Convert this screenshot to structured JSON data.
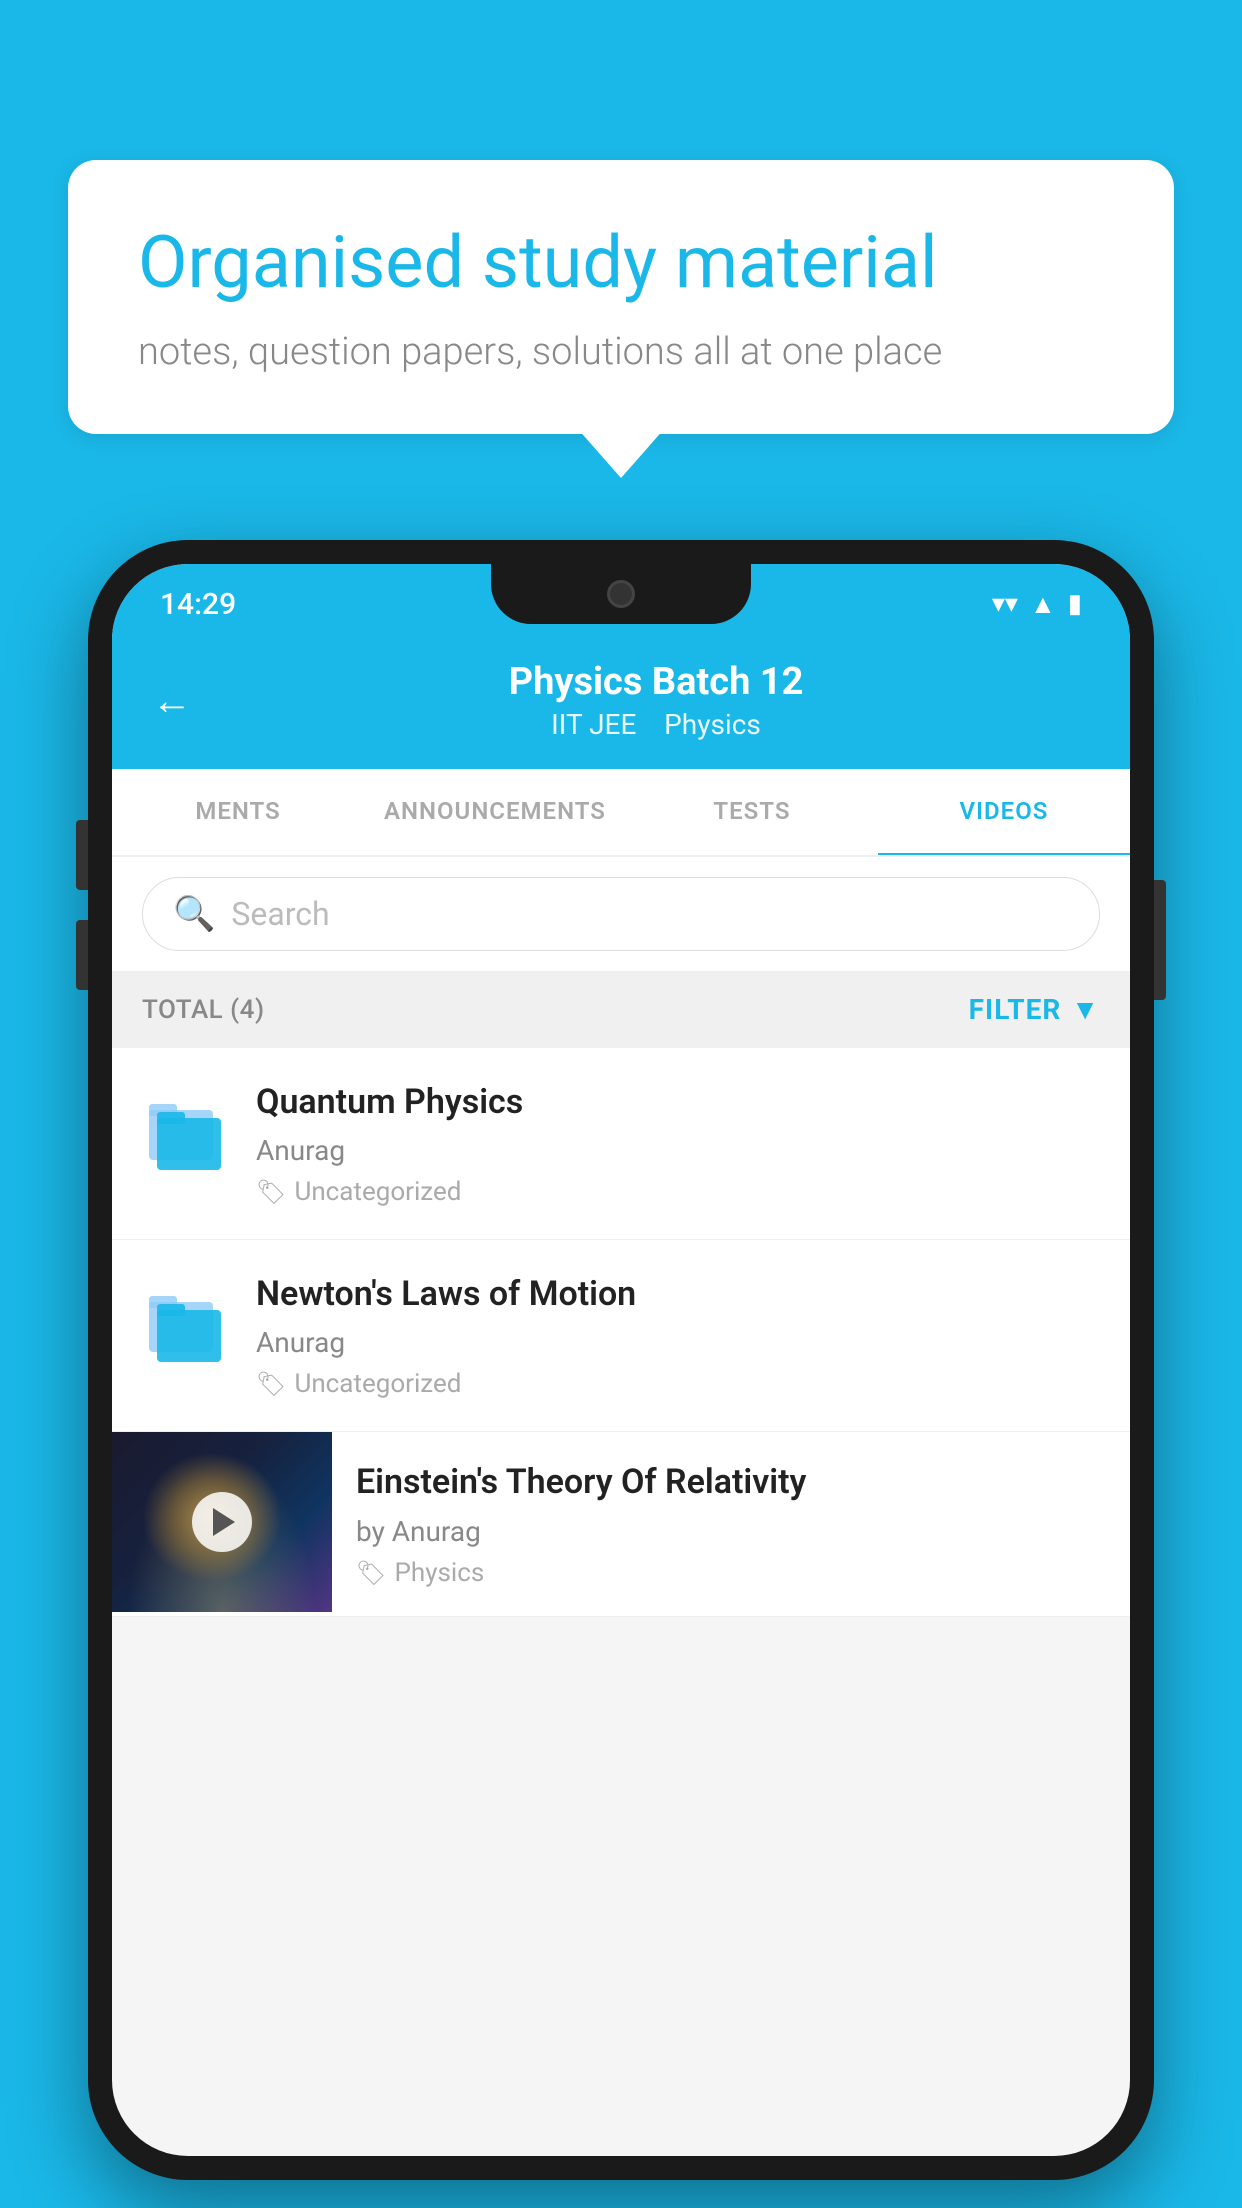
{
  "page": {
    "background_color": "#1ab8e8"
  },
  "hero": {
    "title": "Organised study material",
    "subtitle": "notes, question papers, solutions all at one place"
  },
  "app": {
    "status_bar": {
      "time": "14:29",
      "wifi": "▾",
      "signal": "▲",
      "battery": "▮"
    },
    "header": {
      "back_label": "←",
      "title": "Physics Batch 12",
      "subtitle_part1": "IIT JEE",
      "subtitle_part2": "Physics"
    },
    "tabs": [
      {
        "label": "MENTS",
        "active": false
      },
      {
        "label": "ANNOUNCEMENTS",
        "active": false
      },
      {
        "label": "TESTS",
        "active": false
      },
      {
        "label": "VIDEOS",
        "active": true
      }
    ],
    "search": {
      "placeholder": "Search"
    },
    "filter": {
      "total_label": "TOTAL (4)",
      "filter_label": "FILTER"
    },
    "videos": [
      {
        "title": "Quantum Physics",
        "author": "Anurag",
        "tag": "Uncategorized",
        "type": "folder"
      },
      {
        "title": "Newton's Laws of Motion",
        "author": "Anurag",
        "tag": "Uncategorized",
        "type": "folder"
      },
      {
        "title": "Einstein's Theory Of Relativity",
        "author": "by Anurag",
        "tag": "Physics",
        "type": "video"
      }
    ]
  }
}
